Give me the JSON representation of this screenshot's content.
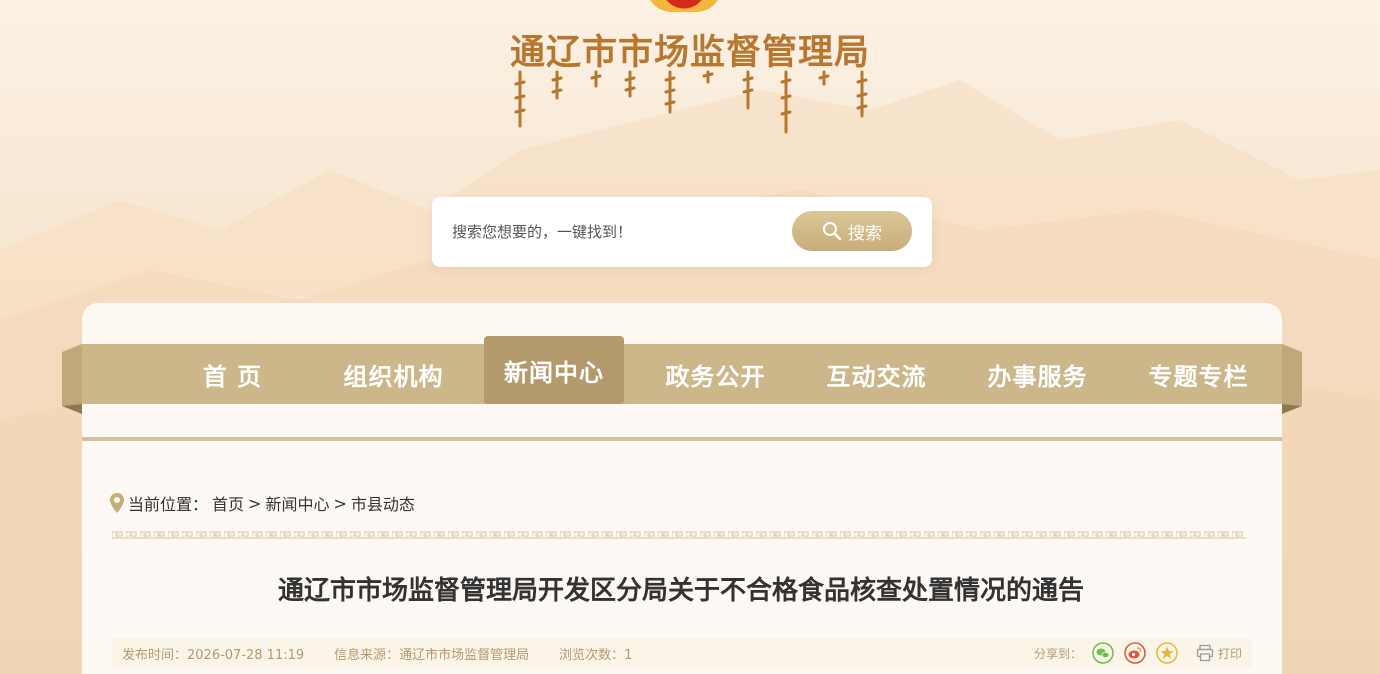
{
  "header": {
    "site_title": "通辽市市场监督管理局"
  },
  "search": {
    "placeholder": "搜索您想要的，一键找到！",
    "button_label": "搜索"
  },
  "nav": {
    "items": [
      {
        "label": "首 页"
      },
      {
        "label": "组织机构"
      },
      {
        "label": "新闻中心"
      },
      {
        "label": "政务公开"
      },
      {
        "label": "互动交流"
      },
      {
        "label": "办事服务"
      },
      {
        "label": "专题专栏"
      }
    ],
    "active_index": 2
  },
  "breadcrumb": {
    "prefix": "当前位置：",
    "items": [
      "首页",
      "新闻中心",
      "市县动态"
    ],
    "separator": ">"
  },
  "article": {
    "title": "通辽市市场监督管理局开发区分局关于不合格食品核查处置情况的通告",
    "publish_time": "发布时间：2026-07-28 11:19",
    "source": "信息来源：通辽市市场监督管理局",
    "views": "浏览次数：1"
  },
  "share": {
    "label": "分享到：",
    "print_label": "打印",
    "icons": [
      "wechat-icon",
      "weibo-icon",
      "qzone-icon"
    ]
  },
  "colors": {
    "title_gold": "#b8772e",
    "nav_bar": "#ccb78b",
    "nav_active": "#b39a6d",
    "search_button": "#c8ad78",
    "meta_text": "#b29a6d"
  }
}
